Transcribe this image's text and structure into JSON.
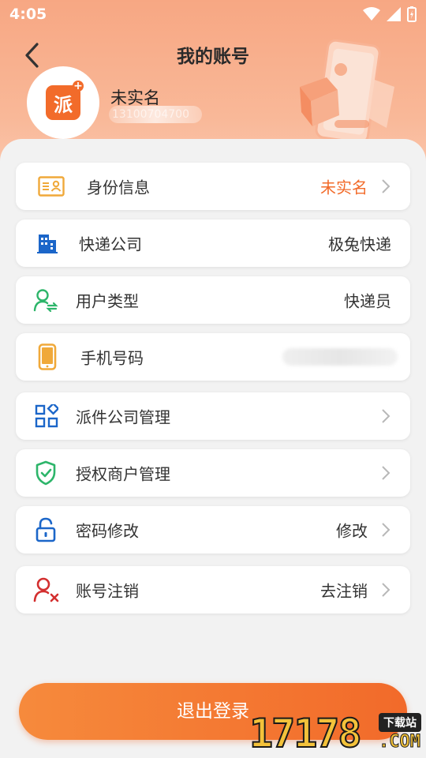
{
  "status_bar": {
    "time": "4:05"
  },
  "header": {
    "title": "我的账号",
    "back_icon": "chevron-left-icon"
  },
  "profile": {
    "avatar_logo_char": "派",
    "avatar_logo_plus": "+",
    "name": "未实名",
    "phone_masked": "13100704700"
  },
  "menu": [
    {
      "id": "identity",
      "label": "身份信息",
      "value": "未实名",
      "icon": "id-card-icon",
      "arrow": true
    },
    {
      "id": "courier-company",
      "label": "快递公司",
      "value": "极兔快递",
      "icon": "building-icon",
      "arrow": false
    },
    {
      "id": "user-type",
      "label": "用户类型",
      "value": "快递员",
      "icon": "user-switch-icon",
      "arrow": false
    },
    {
      "id": "phone",
      "label": "手机号码",
      "value": "",
      "icon": "mobile-icon",
      "arrow": false
    },
    {
      "id": "dispatch-company",
      "label": "派件公司管理",
      "value": "",
      "icon": "grid-apps-icon",
      "arrow": true
    },
    {
      "id": "merchant-auth",
      "label": "授权商户管理",
      "value": "",
      "icon": "shield-check-icon",
      "arrow": true
    },
    {
      "id": "password",
      "label": "密码修改",
      "value": "修改",
      "icon": "unlock-icon",
      "arrow": true
    },
    {
      "id": "cancel-account",
      "label": "账号注销",
      "value": "去注销",
      "icon": "user-remove-icon",
      "arrow": true
    }
  ],
  "logout_label": "退出登录",
  "watermark": {
    "number": "17178",
    "tag": "下载站",
    "domain": ".COM"
  },
  "colors": {
    "accent": "#f26b2a",
    "header_gradient_top": "#f7a783",
    "background": "#f2f2f2"
  }
}
